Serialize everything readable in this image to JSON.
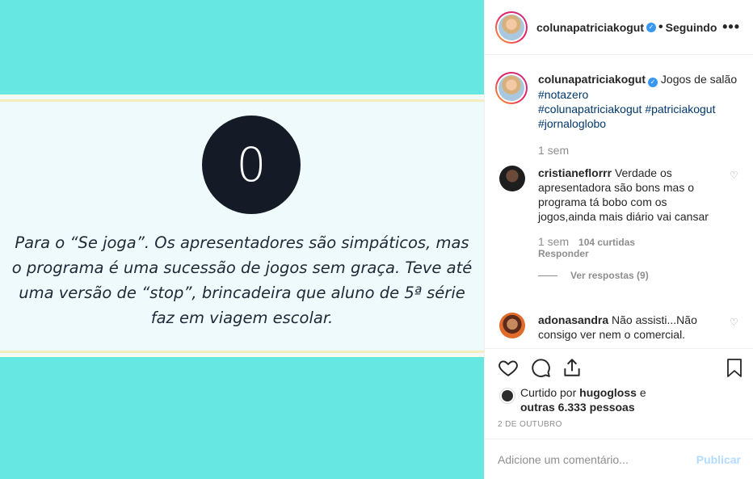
{
  "image": {
    "grade": "0",
    "review": "Para o “Se joga”. Os apresentadores são simpáticos, mas o programa é uma sucessão de jogos sem graça. Teve até uma versão de “stop”, brincadeira que aluno de 5ª série faz em viagem escolar."
  },
  "header": {
    "username": "colunapatriciakogut",
    "separator": "•",
    "follow_state": "Seguindo",
    "more": "•••"
  },
  "caption": {
    "username": "colunapatriciakogut",
    "text": "Jogos de salão",
    "hashtags": [
      "#notazero",
      "#colunapatriciakogut",
      "#patriciakogut",
      "#jornaloglobo"
    ],
    "time": "1 sem"
  },
  "comments": [
    {
      "username": "cristianeflorrr",
      "text": "Verdade os apresentadora são bons mas o programa tá bobo com os jogos,ainda mais diário vai cansar",
      "time": "1 sem",
      "likes": "104 curtidas",
      "reply": "Responder",
      "view_replies": "Ver respostas (9)"
    },
    {
      "username": "adonasandra",
      "text": "Não assisti...Não consigo ver nem o comercial."
    }
  ],
  "likes": {
    "prefix": "Curtido por",
    "user": "hugogloss",
    "conj": "e",
    "others": "outras 6.333 pessoas"
  },
  "date": "2 de outubro",
  "composer": {
    "placeholder": "Adicione um comentário...",
    "publish": "Publicar"
  }
}
